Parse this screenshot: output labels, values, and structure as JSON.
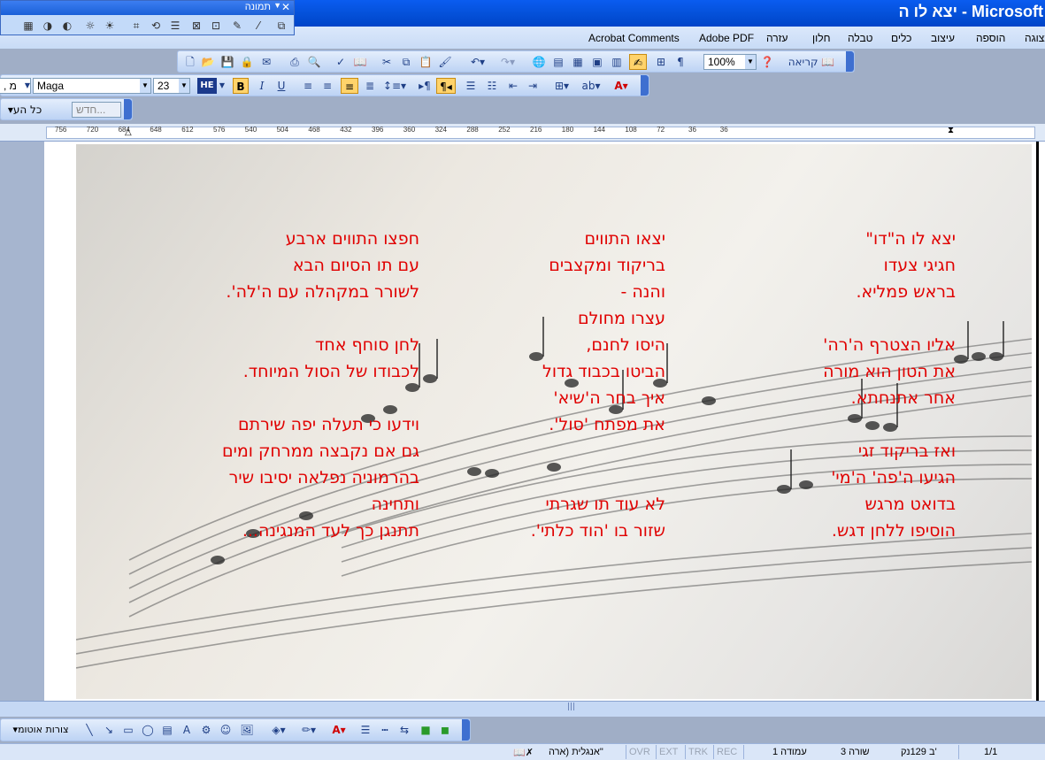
{
  "window": {
    "title": "יצא לו ה - Microsoft"
  },
  "picture_toolbar": {
    "title": "תמונה"
  },
  "menus": [
    "Acrobat Comments",
    "Adobe PDF",
    "עזרה",
    "חלון",
    "טבלה",
    "כלים",
    "עיצוב",
    "הוספה",
    "תצוגה"
  ],
  "standard_toolbar": {
    "zoom": "100%",
    "read_label": "קריאה"
  },
  "format_toolbar": {
    "font": "Maga",
    "size": "23",
    "left_field": ", מ"
  },
  "extra_toolbar": {
    "new_label": "חדש...",
    "all_label": "כל הע"
  },
  "ruler": {
    "ticks": [
      "756",
      "720",
      "684",
      "648",
      "612",
      "576",
      "540",
      "504",
      "468",
      "432",
      "396",
      "360",
      "324",
      "288",
      "252",
      "216",
      "180",
      "144",
      "108",
      "72",
      "36",
      "36"
    ]
  },
  "poem": {
    "col1": [
      "יצא לו ה\"דו\"",
      "חגיגי צעדו",
      "בראש פמליא.",
      "",
      "אליו הצטרף ה'רה'",
      "את הטון הוא מורה",
      "אחר אתנחתא.",
      "",
      "ואז בריקוד זגי",
      "הגיעו ה'פה' ה'מי'",
      "בדואט מרגש",
      "הוסיפו ללחן דגש."
    ],
    "col2": [
      "יצאו התווים",
      "בריקוד ומקצבים",
      "והנה -",
      "עצרו מחולם",
      "היסו לחנם,",
      "הביטו בכבוד גדול",
      "איך בחר ה'שיא'",
      "את מפתח 'סול'.",
      "",
      "",
      "לא עוד תו שגרתי",
      "שזור בו 'הוד כלתי'."
    ],
    "col3": [
      "חפצו התווים ארבע",
      "עם תו הסיום הבא",
      "לשורר במקהלה עם ה'לה'.",
      "",
      "לחן סוחף אחד",
      "לכבודו של הסול המיוחד.",
      "",
      "וידעו כי תעלה יפה שירתם",
      "גם אם נקבצה ממרחק ומים",
      "בהרמוניה נפלאה יסיבו שיר",
      "ותחינה",
      "תתנגן כך לעד המנגינה..."
    ]
  },
  "draw_toolbar": {
    "autoshapes": "צורות אוטומ"
  },
  "status": {
    "pages": "1/1",
    "section": "ב 129נק'",
    "line": "שורה 3",
    "page": "עמודה 1",
    "rec": "REC",
    "trk": "TRK",
    "ext": "EXT",
    "ovr": "OVR",
    "language": "אנגלית (ארה\""
  }
}
